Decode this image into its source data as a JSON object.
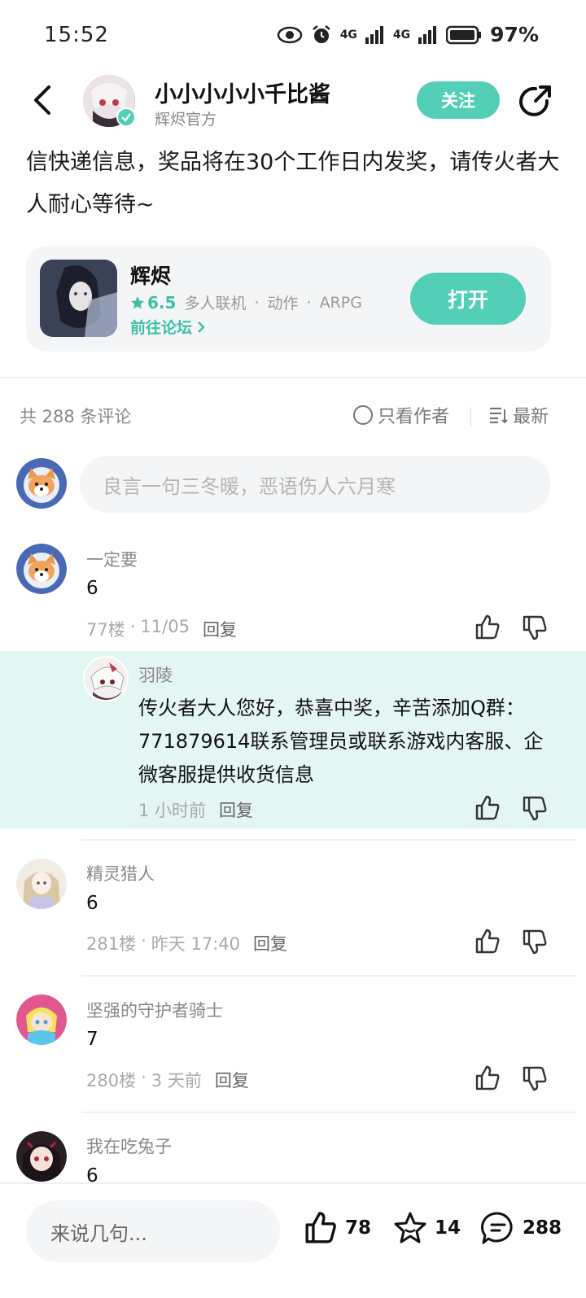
{
  "status_bar": {
    "time": "15:52",
    "network1": "4G",
    "network2": "4G",
    "battery": "97%"
  },
  "header": {
    "author_name": "小小小小小千比酱",
    "author_sub": "辉烬官方",
    "follow_label": "关注"
  },
  "post": {
    "body": "信快递信息，奖品将在30个工作日内发奖，请传火者大人耐心等待~"
  },
  "game_card": {
    "name": "辉烬",
    "rating": "6.5",
    "tags": [
      "多人联机",
      "动作",
      "ARPG"
    ],
    "forum_link": "前往论坛",
    "open_label": "打开"
  },
  "comments_bar": {
    "count_text": "共 288 条评论",
    "author_only": "只看作者",
    "sort_label": "最新"
  },
  "comment_input": {
    "placeholder": "良言一句三冬暖，恶语伤人六月寒"
  },
  "comments": [
    {
      "name": "一定要",
      "text": "6",
      "floor": "77楼",
      "time": "11/05",
      "reply": "回复"
    },
    {
      "name": "精灵猎人",
      "text": "6",
      "floor": "281楼",
      "time": "昨天 17:40",
      "reply": "回复"
    },
    {
      "name": "坚强的守护者骑士",
      "text": "7",
      "floor": "280楼",
      "time": "3 天前",
      "reply": "回复"
    },
    {
      "name": "我在吃兔子",
      "text": "6"
    }
  ],
  "reply": {
    "name": "羽陵",
    "text": "传火者大人您好，恭喜中奖，辛苦添加Q群：771879614联系管理员或联系游戏内客服、企微客服提供收货信息",
    "time": "1 小时前",
    "reply": "回复"
  },
  "bottom_bar": {
    "input_label": "来说几句...",
    "likes": "78",
    "favorites": "14",
    "comments": "288"
  },
  "colors": {
    "accent": "#52cfb6",
    "reply_bg": "#e4f6f3"
  }
}
